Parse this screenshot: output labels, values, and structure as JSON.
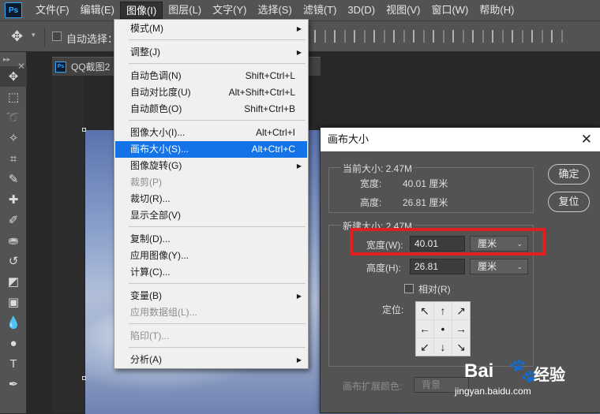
{
  "app": {
    "logo": "Ps"
  },
  "menubar": {
    "items": [
      "文件(F)",
      "编辑(E)",
      "图像(I)",
      "图层(L)",
      "文字(Y)",
      "选择(S)",
      "滤镜(T)",
      "3D(D)",
      "视图(V)",
      "窗口(W)",
      "帮助(H)"
    ],
    "active": "图像(I)"
  },
  "options": {
    "auto_select_label": "自动选择：",
    "tool_icon": "move-tool-icon"
  },
  "document": {
    "tab_title": "QQ截图2"
  },
  "image_menu": {
    "items": [
      {
        "label": "模式(M)",
        "shortcut": "",
        "submenu": true
      },
      {
        "label": "调整(J)",
        "shortcut": "",
        "submenu": true
      },
      {
        "label": "自动色调(N)",
        "shortcut": "Shift+Ctrl+L"
      },
      {
        "label": "自动对比度(U)",
        "shortcut": "Alt+Shift+Ctrl+L"
      },
      {
        "label": "自动颜色(O)",
        "shortcut": "Shift+Ctrl+B"
      },
      {
        "label": "图像大小(I)...",
        "shortcut": "Alt+Ctrl+I"
      },
      {
        "label": "画布大小(S)...",
        "shortcut": "Alt+Ctrl+C",
        "highlighted": true
      },
      {
        "label": "图像旋转(G)",
        "shortcut": "",
        "submenu": true
      },
      {
        "label": "裁剪(P)",
        "shortcut": "",
        "disabled": true
      },
      {
        "label": "裁切(R)...",
        "shortcut": ""
      },
      {
        "label": "显示全部(V)",
        "shortcut": ""
      },
      {
        "label": "复制(D)...",
        "shortcut": ""
      },
      {
        "label": "应用图像(Y)...",
        "shortcut": ""
      },
      {
        "label": "计算(C)...",
        "shortcut": ""
      },
      {
        "label": "变量(B)",
        "shortcut": "",
        "submenu": true
      },
      {
        "label": "应用数据组(L)...",
        "shortcut": "",
        "disabled": true
      },
      {
        "label": "陷印(T)...",
        "shortcut": "",
        "disabled": true
      },
      {
        "label": "分析(A)",
        "shortcut": "",
        "submenu": true
      }
    ]
  },
  "dialog": {
    "title": "画布大小",
    "current_size_label": "当前大小: 2.47M",
    "current_width_label": "宽度:",
    "current_width_value": "40.01 厘米",
    "current_height_label": "高度:",
    "current_height_value": "26.81 厘米",
    "new_size_label": "新建大小: 2.47M",
    "width_label": "宽度(W):",
    "width_value": "40.01",
    "width_unit": "厘米",
    "height_label": "高度(H):",
    "height_value": "26.81",
    "height_unit": "厘米",
    "relative_label": "相对(R)",
    "anchor_label": "定位:",
    "anchor_arrows": [
      "↖",
      "↑",
      "↗",
      "←",
      "•",
      "→",
      "↙",
      "↓",
      "↘"
    ],
    "extension_color_label": "画布扩展颜色:",
    "extension_color_value": "背景",
    "ok_label": "确定",
    "reset_label": "复位"
  },
  "watermark": {
    "brand": "Bai",
    "brand2": "经验",
    "url": "jingyan.baidu.com"
  }
}
